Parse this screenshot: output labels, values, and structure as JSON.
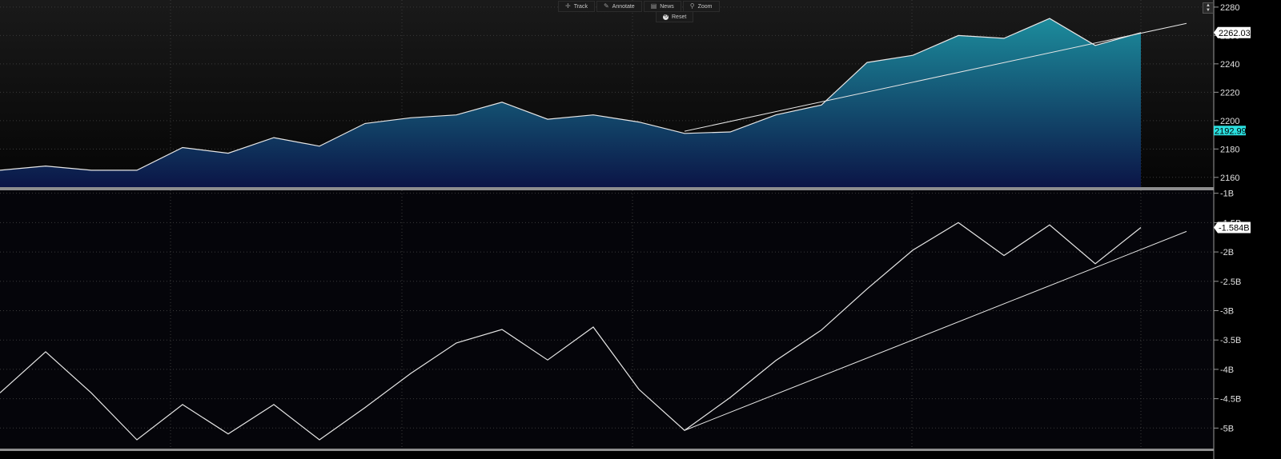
{
  "toolbar": {
    "track": {
      "label": "Track",
      "icon": "crosshair-icon"
    },
    "annotate": {
      "label": "Annotate",
      "icon": "pencil-icon"
    },
    "news": {
      "label": "News",
      "icon": "newspaper-icon"
    },
    "zoom": {
      "label": "Zoom",
      "icon": "magnifier-icon"
    },
    "reset": {
      "label": "Reset",
      "icon": "reset-icon"
    }
  },
  "colors": {
    "background": "#000000",
    "line": "#e6e6e6",
    "area_top": "#1c8c9c",
    "area_bottom": "#0b1446",
    "last_price_label_bg": "#ffffff",
    "alt_price_label_bg": "#2be0e0",
    "grid": "#3a3a3a"
  },
  "chart_data": [
    {
      "type": "area",
      "x": [
        0,
        1,
        2,
        3,
        4,
        5,
        6,
        7,
        8,
        9,
        10,
        11,
        12,
        13,
        14,
        15,
        16,
        17,
        18,
        19,
        20,
        21,
        22,
        23,
        24,
        25
      ],
      "y": [
        2165,
        2168,
        2165,
        2165,
        2181,
        2177,
        2188,
        2182,
        2198,
        2202,
        2204,
        2213,
        2201,
        2204,
        2199,
        2191,
        2192,
        2204,
        2211,
        2241,
        2246,
        2260,
        2258,
        2272,
        2253,
        2262.03
      ],
      "trendline": {
        "from": [
          15,
          2192.5
        ],
        "to": [
          26,
          2268.5
        ]
      },
      "ylim": [
        2152,
        2285
      ],
      "yticks": [
        2160,
        2180,
        2200,
        2220,
        2240,
        2260,
        2280
      ],
      "ytick_labels": [
        "2160",
        "2180",
        "2200",
        "2220",
        "2240",
        "2260",
        "2280"
      ],
      "last_value_label": "2262.03",
      "alt_value": 2192.99,
      "alt_value_label": "2192.99",
      "grid": true
    },
    {
      "type": "line",
      "x": [
        0,
        1,
        2,
        3,
        4,
        5,
        6,
        7,
        8,
        9,
        10,
        11,
        12,
        13,
        14,
        15,
        16,
        17,
        18,
        19,
        20,
        21,
        22,
        23,
        24,
        25
      ],
      "y": [
        -4.4,
        -3.7,
        -4.4,
        -5.2,
        -4.6,
        -5.1,
        -4.6,
        -5.2,
        -4.65,
        -4.07,
        -3.55,
        -3.32,
        -3.84,
        -3.28,
        -4.34,
        -5.04,
        -4.48,
        -3.85,
        -3.33,
        -2.63,
        -1.97,
        -1.5,
        -2.06,
        -1.54,
        -2.2,
        -1.584
      ],
      "trendline": {
        "from": [
          15,
          -5.04
        ],
        "to": [
          26,
          -1.65
        ]
      },
      "ylim": [
        -5.35,
        -0.95
      ],
      "yticks": [
        -1,
        -1.5,
        -2,
        -2.5,
        -3,
        -3.5,
        -4,
        -4.5,
        -5
      ],
      "ytick_labels": [
        "-1B",
        "-1.5B",
        "-2B",
        "-2.5B",
        "-3B",
        "-3.5B",
        "-4B",
        "-4.5B",
        "-5B"
      ],
      "last_value_label": "-1.584B",
      "grid": true
    }
  ]
}
